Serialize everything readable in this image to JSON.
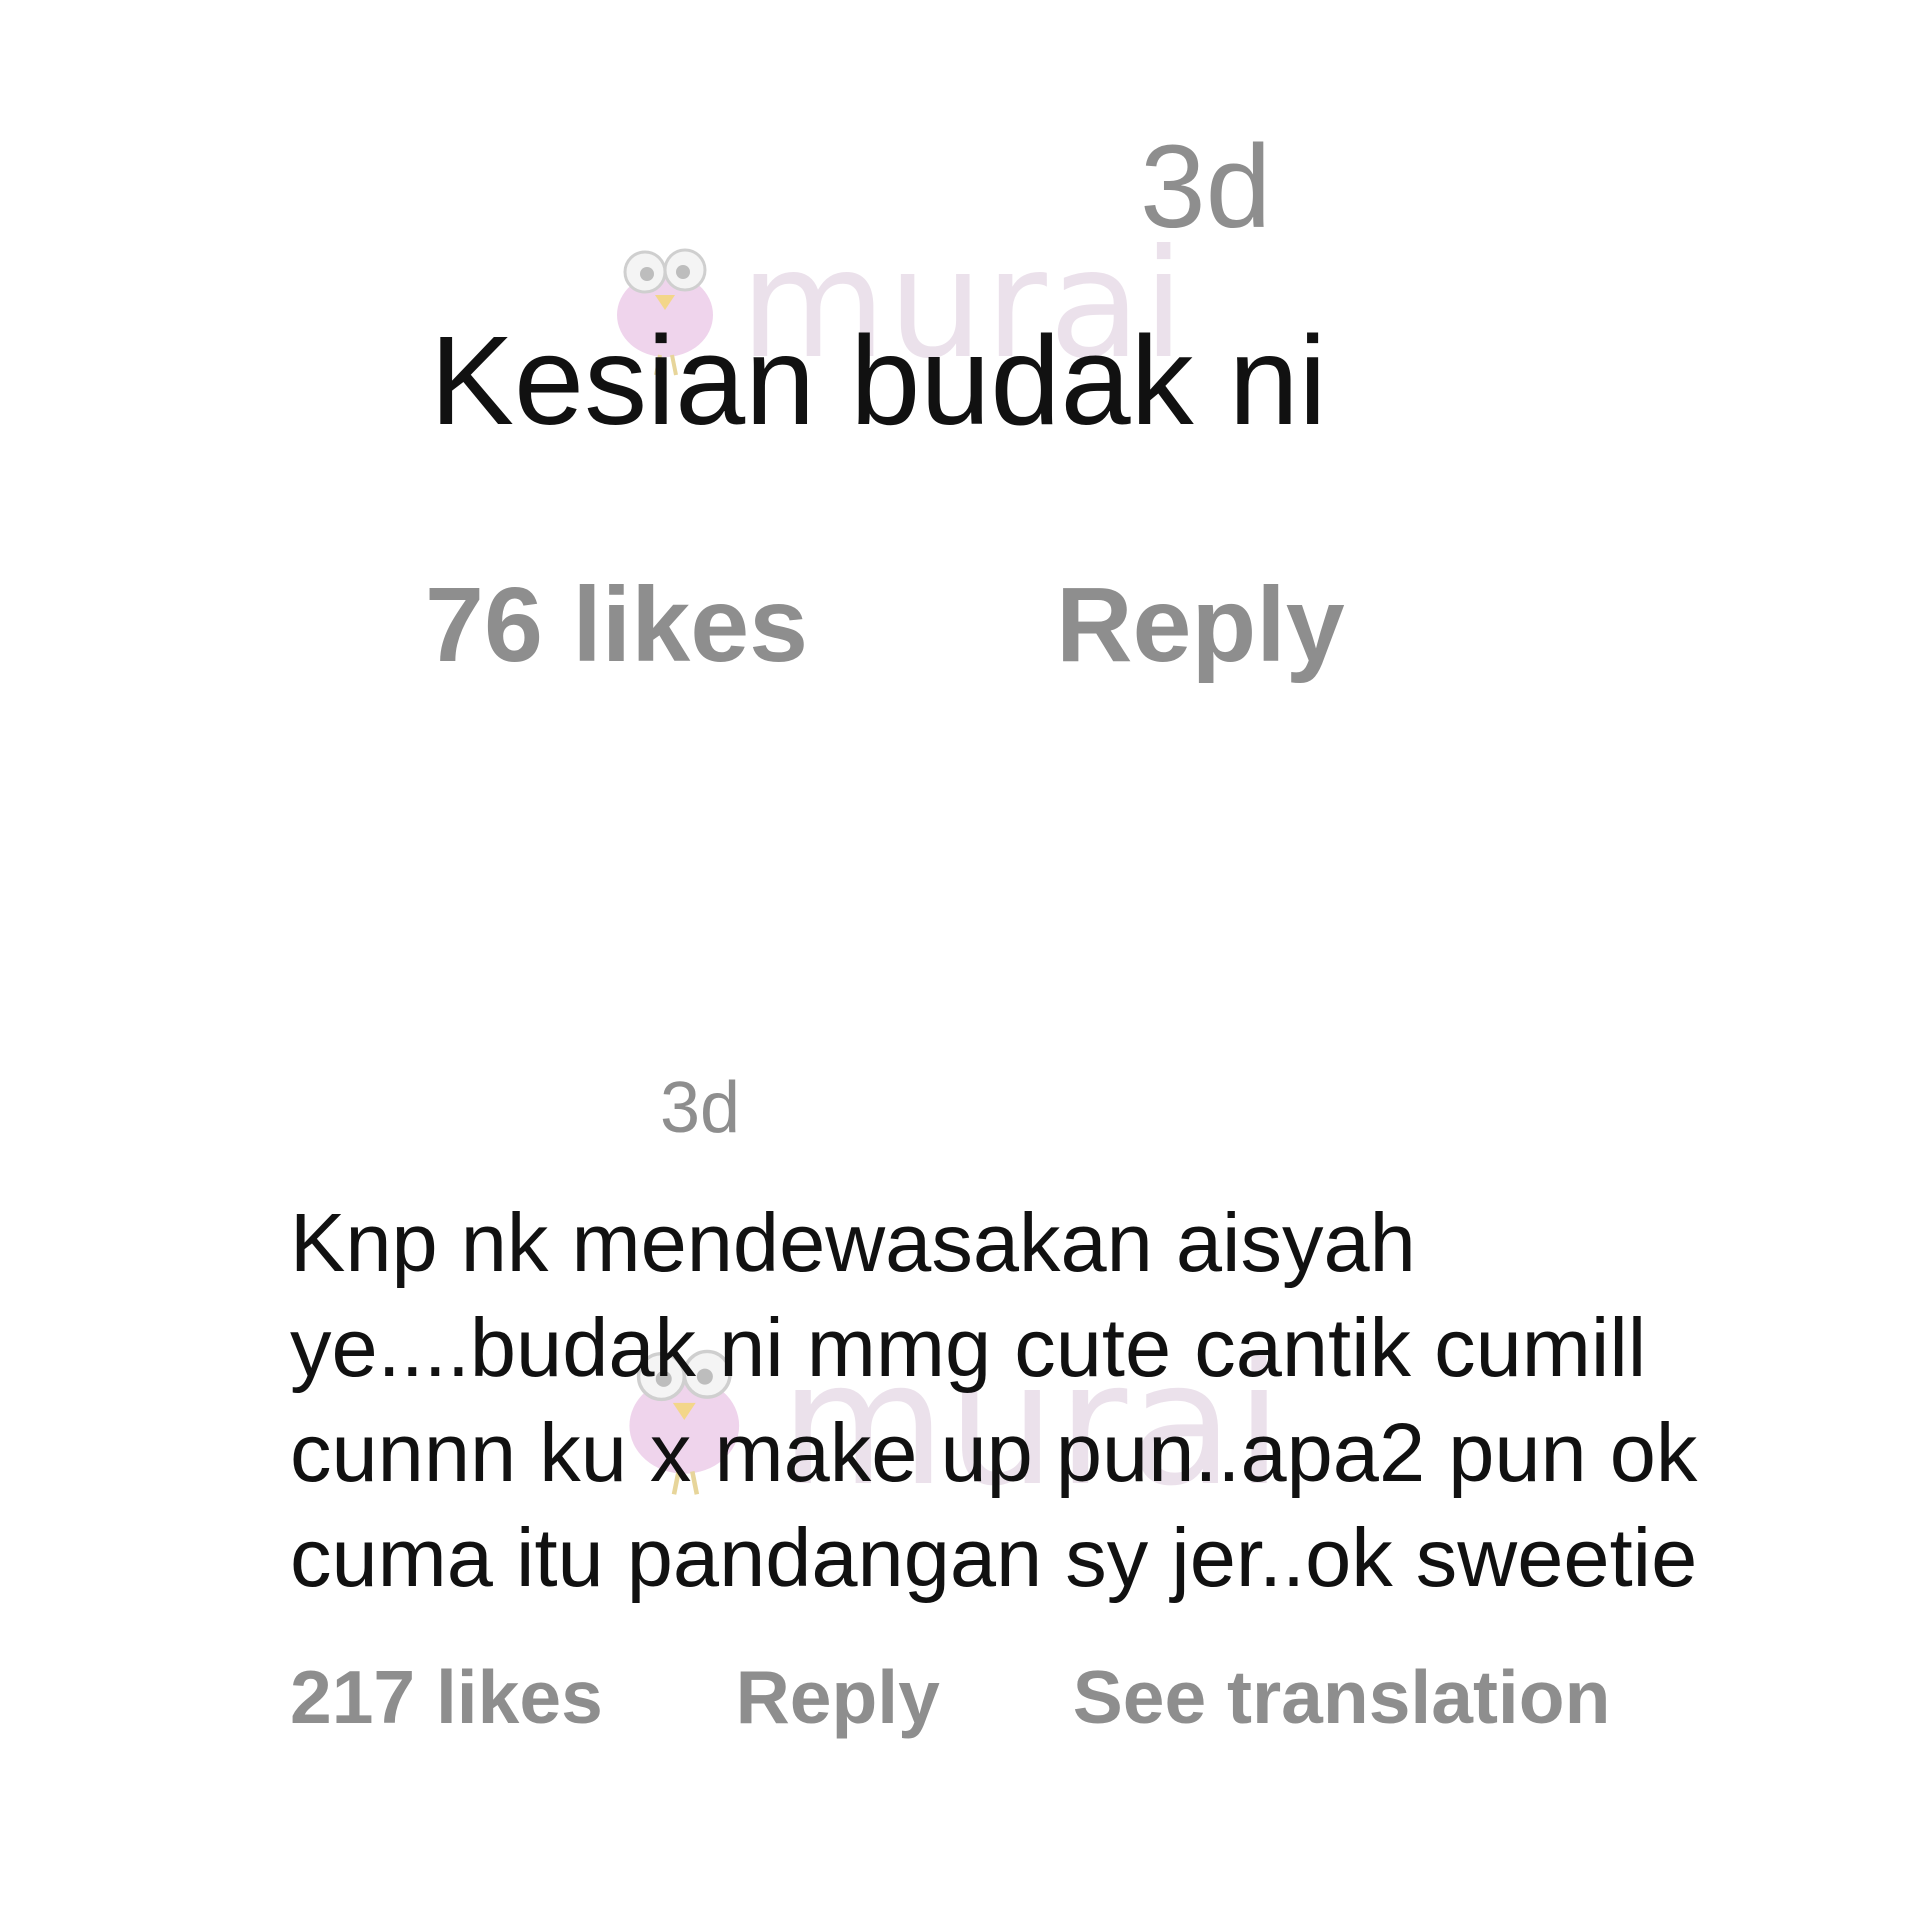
{
  "comments": [
    {
      "time": "3d",
      "text_lines": [
        "Kesian budak ni"
      ],
      "likes": "76 likes",
      "reply_label": "Reply"
    },
    {
      "time": "3d",
      "text_lines": [
        "Knp nk mendewasakan aisyah",
        "ye....budak ni mmg cute cantik cumill",
        "cunnn ku x make up pun..apa2 pun ok",
        "cuma itu pandangan sy jer..ok sweetie"
      ],
      "likes": "217 likes",
      "reply_label": "Reply",
      "translation_label": "See translation"
    }
  ],
  "watermark": {
    "text": "murai",
    "icon": "bird-mascot-icon",
    "color": "#e8dce8"
  }
}
